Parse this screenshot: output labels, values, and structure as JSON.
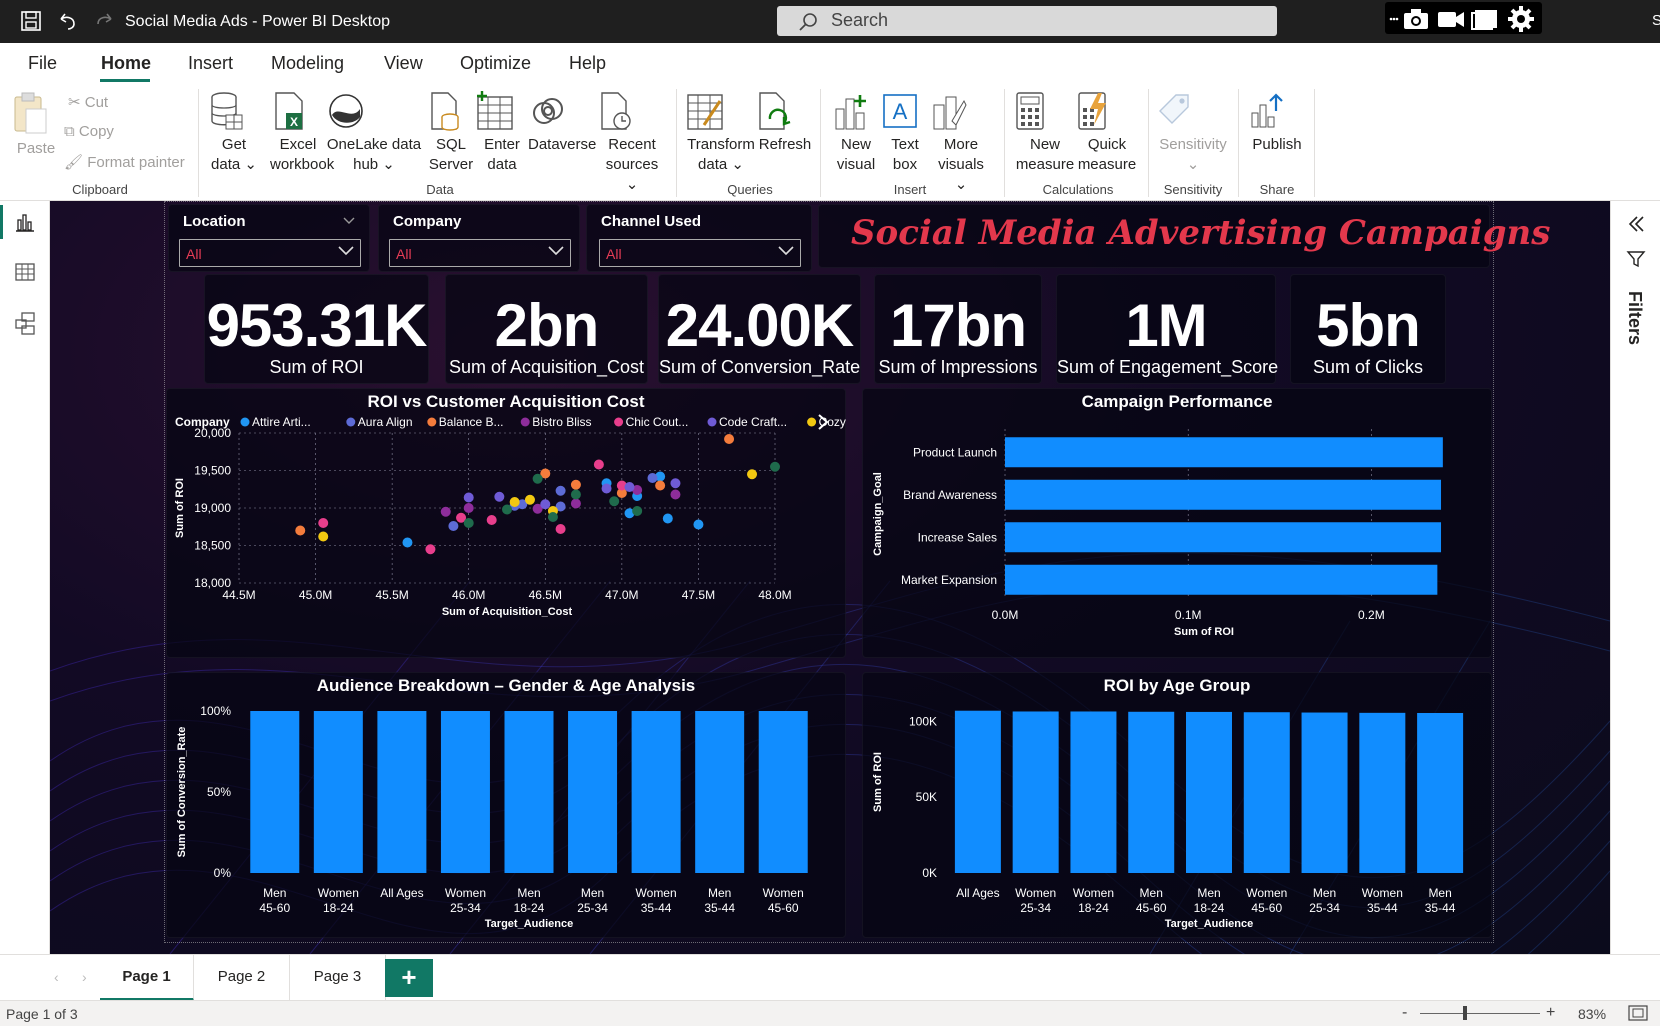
{
  "window": {
    "title": "Social Media Ads - Power BI Desktop",
    "search_placeholder": "Search",
    "user_initial": "S"
  },
  "menu": [
    "File",
    "Home",
    "Insert",
    "Modeling",
    "View",
    "Optimize",
    "Help"
  ],
  "ribbon": {
    "clipboard": {
      "paste": "Paste",
      "cut": "Cut",
      "copy": "Copy",
      "format_painter": "Format painter",
      "group": "Clipboard"
    },
    "data": {
      "get_data": [
        "Get",
        "data"
      ],
      "excel": [
        "Excel",
        "workbook"
      ],
      "onelake": [
        "OneLake data",
        "hub"
      ],
      "sql": [
        "SQL",
        "Server"
      ],
      "enter": [
        "Enter",
        "data"
      ],
      "dataverse": "Dataverse",
      "recent": [
        "Recent",
        "sources"
      ],
      "group": "Data"
    },
    "queries": {
      "transform": [
        "Transform",
        "data"
      ],
      "refresh": "Refresh",
      "group": "Queries"
    },
    "insert": {
      "new_visual": [
        "New",
        "visual"
      ],
      "text_box": [
        "Text",
        "box"
      ],
      "more_visuals": [
        "More",
        "visuals"
      ],
      "group": "Insert"
    },
    "calculations": {
      "new_measure": [
        "New",
        "measure"
      ],
      "quick_measure": [
        "Quick",
        "measure"
      ],
      "group": "Calculations"
    },
    "sensitivity": {
      "label": "Sensitivity",
      "group": "Sensitivity"
    },
    "share": {
      "publish": "Publish",
      "group": "Share"
    }
  },
  "filters_pane": {
    "label": "Filters"
  },
  "slicers": [
    {
      "title": "Location",
      "value": "All"
    },
    {
      "title": "Company",
      "value": "All"
    },
    {
      "title": "Channel Used",
      "value": "All"
    }
  ],
  "report_title": "Social Media Advertising Campaigns",
  "cards": [
    {
      "value": "953.31K",
      "label": "Sum of ROI"
    },
    {
      "value": "2bn",
      "label": "Sum of Acquisition_Cost"
    },
    {
      "value": "24.00K",
      "label": "Sum of Conversion_Rate"
    },
    {
      "value": "17bn",
      "label": "Sum of Impressions"
    },
    {
      "value": "1M",
      "label": "Sum of Engagement_Score"
    },
    {
      "value": "5bn",
      "label": "Sum of Clicks"
    }
  ],
  "chart_data": [
    {
      "type": "scatter",
      "title": "ROI vs Customer Acquisition Cost",
      "xlabel": "Sum of Acquisition_Cost",
      "ylabel": "Sum of ROI",
      "legend_title": "Company",
      "legend_placement": "top",
      "xlim": [
        44.5,
        48.0
      ],
      "ylim": [
        18000,
        20000
      ],
      "x_ticks": [
        "44.5M",
        "45.0M",
        "45.5M",
        "46.0M",
        "46.5M",
        "47.0M",
        "47.5M",
        "48.0M"
      ],
      "y_ticks": [
        "18,000",
        "18,500",
        "19,000",
        "19,500",
        "20,000"
      ],
      "grid": true,
      "series": [
        {
          "name": "Attire Arti...",
          "color": "#2196f3",
          "points": [
            [
              45.6,
              18540
            ],
            [
              46.9,
              19330
            ],
            [
              47.1,
              19160
            ],
            [
              47.25,
              19420
            ],
            [
              47.3,
              18860
            ],
            [
              47.5,
              18780
            ],
            [
              47.05,
              18930
            ]
          ]
        },
        {
          "name": "Aura Align",
          "color": "#5d6bd6",
          "points": [
            [
              45.9,
              18760
            ],
            [
              46.3,
              19030
            ],
            [
              46.6,
              19020
            ],
            [
              46.6,
              19230
            ],
            [
              47.2,
              19400
            ],
            [
              46.35,
              19050
            ]
          ]
        },
        {
          "name": "Balance B...",
          "color": "#f47c3c",
          "points": [
            [
              44.9,
              18700
            ],
            [
              46.7,
              19310
            ],
            [
              47.0,
              19200
            ],
            [
              47.25,
              19300
            ],
            [
              47.7,
              19920
            ],
            [
              46.5,
              19460
            ]
          ]
        },
        {
          "name": "Bistro Bliss",
          "color": "#8e2d9b",
          "points": [
            [
              45.85,
              18950
            ],
            [
              46.45,
              18990
            ],
            [
              46.7,
              19060
            ],
            [
              47.1,
              19240
            ],
            [
              47.35,
              19180
            ],
            [
              46.0,
              19000
            ]
          ]
        },
        {
          "name": "Chic Cout...",
          "color": "#e83e8c",
          "points": [
            [
              45.05,
              18800
            ],
            [
              45.75,
              18450
            ],
            [
              45.95,
              18870
            ],
            [
              46.15,
              18840
            ],
            [
              46.6,
              18720
            ],
            [
              46.85,
              19580
            ],
            [
              47.0,
              19300
            ]
          ]
        },
        {
          "name": "Code Craft...",
          "color": "#6f5bd6",
          "points": [
            [
              46.0,
              19140
            ],
            [
              46.5,
              19050
            ],
            [
              46.9,
              19260
            ],
            [
              47.05,
              19280
            ],
            [
              47.35,
              19330
            ],
            [
              46.2,
              19150
            ]
          ]
        },
        {
          "name": "Cozy Cor...",
          "color": "#f2c811",
          "points": [
            [
              45.05,
              18620
            ],
            [
              46.3,
              19080
            ],
            [
              46.55,
              18960
            ],
            [
              47.85,
              19450
            ],
            [
              46.4,
              19110
            ]
          ]
        },
        {
          "name": "",
          "color": "#1f6b4c",
          "points": [
            [
              46.0,
              18800
            ],
            [
              46.25,
              18980
            ],
            [
              46.45,
              19390
            ],
            [
              46.7,
              19180
            ],
            [
              46.95,
              19090
            ],
            [
              47.1,
              18960
            ],
            [
              48.0,
              19550
            ],
            [
              46.55,
              18880
            ]
          ]
        }
      ]
    },
    {
      "type": "bar",
      "orientation": "horizontal",
      "title": "Campaign Performance",
      "xlabel": "Sum of ROI",
      "ylabel": "Campaign_Goal",
      "categories": [
        "Product Launch",
        "Brand Awareness",
        "Increase Sales",
        "Market Expansion"
      ],
      "values": [
        0.239,
        0.238,
        0.238,
        0.236
      ],
      "xlim": [
        0,
        0.25
      ],
      "x_ticks": [
        "0.0M",
        "0.1M",
        "0.2M"
      ],
      "color": "#118dff"
    },
    {
      "type": "bar",
      "title": "Audience Breakdown – Gender & Age Analysis",
      "xlabel": "Target_Audience",
      "ylabel": "Sum of Conversion_Rate",
      "categories": [
        [
          "Men",
          "45-60"
        ],
        [
          "Women",
          "18-24"
        ],
        [
          "All Ages",
          ""
        ],
        [
          "Women",
          "25-34"
        ],
        [
          "Men",
          "18-24"
        ],
        [
          "Men",
          "25-34"
        ],
        [
          "Women",
          "35-44"
        ],
        [
          "Men",
          "35-44"
        ],
        [
          "Women",
          "45-60"
        ]
      ],
      "values": [
        100,
        100,
        100,
        100,
        100,
        100,
        100,
        100,
        100
      ],
      "ylim": [
        0,
        100
      ],
      "y_ticks": [
        "0%",
        "50%",
        "100%"
      ],
      "color": "#118dff"
    },
    {
      "type": "bar",
      "title": "ROI by Age Group",
      "xlabel": "Target_Audience",
      "ylabel": "Sum of ROI",
      "categories": [
        [
          "All Ages",
          ""
        ],
        [
          "Women",
          "25-34"
        ],
        [
          "Women",
          "18-24"
        ],
        [
          "Men",
          "45-60"
        ],
        [
          "Men",
          "18-24"
        ],
        [
          "Women",
          "45-60"
        ],
        [
          "Men",
          "25-34"
        ],
        [
          "Women",
          "35-44"
        ],
        [
          "Men",
          "35-44"
        ]
      ],
      "values": [
        107,
        106.5,
        106.5,
        106.3,
        106.2,
        106,
        105.8,
        105.6,
        105.5
      ],
      "ylim": [
        0,
        120
      ],
      "y_ticks": [
        "0K",
        "50K",
        "100K"
      ],
      "color": "#118dff"
    }
  ],
  "pages": [
    "Page 1",
    "Page 2",
    "Page 3"
  ],
  "add_page": "+",
  "status": {
    "page_info": "Page 1 of 3",
    "zoom": "83%"
  }
}
